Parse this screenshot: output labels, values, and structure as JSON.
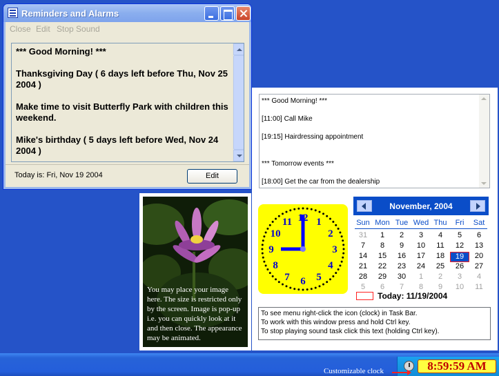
{
  "reminder_window": {
    "title": "Reminders and Alarms",
    "menu": [
      "Close",
      "Edit",
      "Stop Sound"
    ],
    "messages": [
      "*** Good Morning! ***",
      "Thanksgiving Day ( 6 days left before Thu, Nov 25 2004 )",
      "Make time to visit Butterfly Park with children this weekend.",
      "Mike's birthday ( 5 days left before Wed, Nov 24 2004 )"
    ],
    "status_text": "Today is: Fri, Nov 19 2004",
    "edit_label": "Edit"
  },
  "picture_panel": {
    "caption": "You may place your image here.  The size is restricted only by the screen. Image is pop-up i.e. you can quickly look at it and then close. The appearance may be animated."
  },
  "events": [
    "*** Good Morning! ***",
    "[11:00] Call Mike",
    "[19:15] Hairdressing appointment",
    "*** Tomorrow events ***",
    "[18:00] Get the car from the dealership"
  ],
  "clock": {
    "numbers": [
      "12",
      "1",
      "2",
      "3",
      "4",
      "5",
      "6",
      "7",
      "8",
      "9",
      "10",
      "11"
    ],
    "hour": 9,
    "minute": 0,
    "face_color": "#ffff00",
    "hand_color": "#0000ff"
  },
  "calendar": {
    "month_label": "November, 2004",
    "weekdays": [
      "Sun",
      "Mon",
      "Tue",
      "Wed",
      "Thu",
      "Fri",
      "Sat"
    ],
    "weeks": [
      [
        "31",
        "1",
        "2",
        "3",
        "4",
        "5",
        "6"
      ],
      [
        "7",
        "8",
        "9",
        "10",
        "11",
        "12",
        "13"
      ],
      [
        "14",
        "15",
        "16",
        "17",
        "18",
        "19",
        "20"
      ],
      [
        "21",
        "22",
        "23",
        "24",
        "25",
        "26",
        "27"
      ],
      [
        "28",
        "29",
        "30",
        "1",
        "2",
        "3",
        "4"
      ],
      [
        "5",
        "6",
        "7",
        "8",
        "9",
        "10",
        "11"
      ]
    ],
    "selected_day": "19",
    "today_text": "Today: 11/19/2004",
    "accent_color": "#0a4dc8"
  },
  "help_lines": [
    "To see menu right-click the icon (clock) in Task Bar.",
    "To work with this window press and hold Ctrl key.",
    "To stop playing sound task click this text (holding Ctrl key)."
  ],
  "taskbar": {
    "clock_time": "8:59:59 AM",
    "clock_caption": "Customizable clock"
  }
}
